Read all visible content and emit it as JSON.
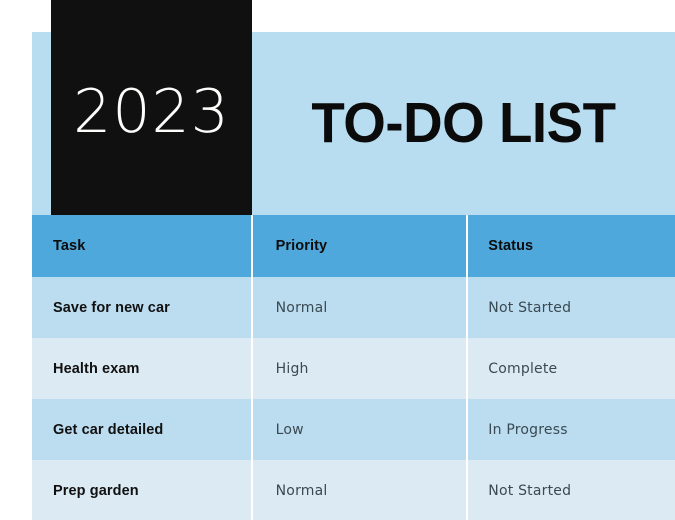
{
  "banner": {
    "year": "2023",
    "title": "TO-DO LIST",
    "banner_color": "#b8dcf0",
    "year_block_color": "#101010",
    "year_text_color": "#fdfdfb",
    "title_text_color": "#0b0b0b"
  },
  "table": {
    "header_color": "#4fa8dc",
    "row_color_odd": "#bcdcf0",
    "row_color_even": "#dceaf4",
    "divider_color": "#ffffff",
    "columns": [
      {
        "key": "task",
        "label": "Task"
      },
      {
        "key": "priority",
        "label": "Priority"
      },
      {
        "key": "status",
        "label": "Status"
      }
    ],
    "rows": [
      {
        "task": "Save for new car",
        "priority": "Normal",
        "status": "Not Started"
      },
      {
        "task": "Health exam",
        "priority": "High",
        "status": "Complete"
      },
      {
        "task": "Get car detailed",
        "priority": "Low",
        "status": "In Progress"
      },
      {
        "task": "Prep garden",
        "priority": "Normal",
        "status": "Not Started"
      }
    ]
  }
}
